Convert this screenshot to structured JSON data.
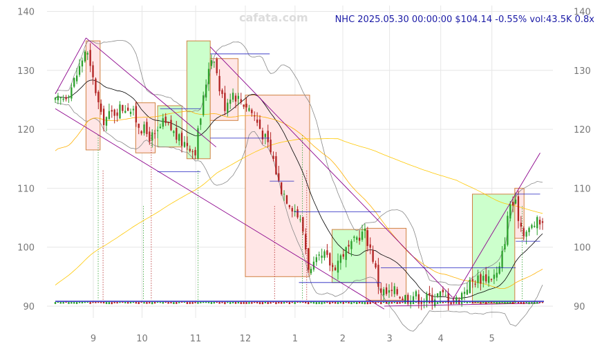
{
  "watermark": "cafata.com",
  "header": {
    "text": "NHC 2025.05.30 00:00:00 $104.14 -0.55% vol:43.5K 0.8x"
  },
  "colors": {
    "up": "#2ca02c",
    "down": "#b22222",
    "bollinger": "#888888",
    "ma_short": "#000000",
    "ma_mid": "#ffb000",
    "ma_long": "#ffc800",
    "trendline": "#8b008b",
    "level_line": "#1f1fbf",
    "box_up_fill": "#ccffcc",
    "box_down_fill": "#ffe6e6",
    "box_stroke": "#d08040",
    "grid": "#e6e6e6"
  },
  "chart_data": {
    "type": "candlestick",
    "ticker": "NHC",
    "ylim": [
      88,
      141
    ],
    "y_ticks": [
      90,
      100,
      110,
      120,
      130,
      140
    ],
    "x_ticks": [
      {
        "label": "9",
        "t": 0.078
      },
      {
        "label": "10",
        "t": 0.178
      },
      {
        "label": "11",
        "t": 0.288
      },
      {
        "label": "12",
        "t": 0.39
      },
      {
        "label": "1",
        "t": 0.492
      },
      {
        "label": "2",
        "t": 0.59
      },
      {
        "label": "3",
        "t": 0.686
      },
      {
        "label": "4",
        "t": 0.791
      },
      {
        "label": "5",
        "t": 0.896
      }
    ],
    "price_anchors": [
      [
        0.0,
        124.5
      ],
      [
        0.018,
        125.5
      ],
      [
        0.035,
        127.5
      ],
      [
        0.05,
        130.5
      ],
      [
        0.063,
        134.0
      ],
      [
        0.072,
        130.0
      ],
      [
        0.082,
        127.0
      ],
      [
        0.095,
        121.5
      ],
      [
        0.105,
        122.0
      ],
      [
        0.13,
        123.5
      ],
      [
        0.15,
        124.0
      ],
      [
        0.17,
        121.0
      ],
      [
        0.19,
        119.0
      ],
      [
        0.205,
        118.5
      ],
      [
        0.22,
        121.0
      ],
      [
        0.238,
        120.0
      ],
      [
        0.255,
        118.0
      ],
      [
        0.275,
        117.5
      ],
      [
        0.286,
        116.0
      ],
      [
        0.298,
        122.0
      ],
      [
        0.315,
        131.0
      ],
      [
        0.325,
        133.0
      ],
      [
        0.335,
        127.5
      ],
      [
        0.348,
        124.0
      ],
      [
        0.362,
        126.5
      ],
      [
        0.378,
        125.0
      ],
      [
        0.395,
        124.0
      ],
      [
        0.41,
        122.0
      ],
      [
        0.43,
        118.5
      ],
      [
        0.447,
        115.0
      ],
      [
        0.46,
        110.5
      ],
      [
        0.478,
        108.0
      ],
      [
        0.495,
        106.0
      ],
      [
        0.508,
        103.0
      ],
      [
        0.522,
        95.5
      ],
      [
        0.538,
        97.5
      ],
      [
        0.553,
        98.5
      ],
      [
        0.57,
        96.5
      ],
      [
        0.59,
        99.0
      ],
      [
        0.608,
        100.0
      ],
      [
        0.622,
        102.0
      ],
      [
        0.635,
        102.5
      ],
      [
        0.65,
        99.0
      ],
      [
        0.665,
        93.0
      ],
      [
        0.68,
        92.0
      ],
      [
        0.7,
        92.5
      ],
      [
        0.715,
        91.5
      ],
      [
        0.735,
        92.0
      ],
      [
        0.755,
        91.0
      ],
      [
        0.77,
        91.5
      ],
      [
        0.788,
        92.0
      ],
      [
        0.805,
        91.5
      ],
      [
        0.825,
        91.0
      ],
      [
        0.845,
        93.5
      ],
      [
        0.862,
        94.5
      ],
      [
        0.88,
        95.0
      ],
      [
        0.897,
        95.0
      ],
      [
        0.91,
        95.5
      ],
      [
        0.92,
        100.0
      ],
      [
        0.933,
        107.5
      ],
      [
        0.945,
        107.0
      ],
      [
        0.958,
        103.0
      ],
      [
        0.97,
        102.5
      ],
      [
        0.982,
        104.0
      ],
      [
        1.0,
        104.14
      ]
    ],
    "last_close": 104.14,
    "change_pct": -0.55,
    "volume": "43.5K",
    "volume_ratio": "0.8x",
    "date": "2025.05.30 00:00:00",
    "boxes": [
      {
        "t0": 0.063,
        "t1": 0.092,
        "top": 135.0,
        "bottom": 116.5,
        "dir": "down"
      },
      {
        "t0": 0.165,
        "t1": 0.205,
        "top": 124.5,
        "bottom": 116.0,
        "dir": "down"
      },
      {
        "t0": 0.21,
        "t1": 0.26,
        "top": 124.0,
        "bottom": 117.0,
        "dir": "up"
      },
      {
        "t0": 0.27,
        "t1": 0.318,
        "top": 135.0,
        "bottom": 115.0,
        "dir": "up"
      },
      {
        "t0": 0.318,
        "t1": 0.375,
        "top": 132.0,
        "bottom": 121.5,
        "dir": "down"
      },
      {
        "t0": 0.39,
        "t1": 0.522,
        "top": 125.8,
        "bottom": 95.0,
        "dir": "down"
      },
      {
        "t0": 0.568,
        "t1": 0.638,
        "top": 103.0,
        "bottom": 94.0,
        "dir": "up"
      },
      {
        "t0": 0.638,
        "t1": 0.72,
        "top": 103.2,
        "bottom": 91.0,
        "dir": "down"
      },
      {
        "t0": 0.856,
        "t1": 0.943,
        "top": 109.0,
        "bottom": 90.5,
        "dir": "up"
      },
      {
        "t0": 0.943,
        "t1": 0.962,
        "top": 110.0,
        "bottom": 101.5,
        "dir": "down"
      }
    ],
    "level_lines": [
      {
        "t0": 0.215,
        "t1": 0.298,
        "y": 123.5
      },
      {
        "t0": 0.21,
        "t1": 0.298,
        "y": 112.8
      },
      {
        "t0": 0.318,
        "t1": 0.44,
        "y": 132.8
      },
      {
        "t0": 0.318,
        "t1": 0.44,
        "y": 118.5
      },
      {
        "t0": 0.44,
        "t1": 0.49,
        "y": 111.2
      },
      {
        "t0": 0.49,
        "t1": 0.668,
        "y": 106.0
      },
      {
        "t0": 0.5,
        "t1": 0.668,
        "y": 94.0
      },
      {
        "t0": 0.668,
        "t1": 0.945,
        "y": 96.5
      },
      {
        "t0": 0.945,
        "t1": 0.995,
        "y": 109.0
      },
      {
        "t0": 0.945,
        "t1": 0.995,
        "y": 101.0
      }
    ],
    "trendlines": [
      {
        "t0": 0.0,
        "y0": 126.0,
        "t1": 0.063,
        "y1": 135.5
      },
      {
        "t0": 0.063,
        "y0": 135.5,
        "t1": 0.33,
        "y1": 117.0
      },
      {
        "t0": 0.0,
        "y0": 123.5,
        "t1": 0.675,
        "y1": 89.5
      },
      {
        "t0": 0.318,
        "y0": 134.0,
        "t1": 0.815,
        "y1": 91.5
      },
      {
        "t0": 0.675,
        "y0": 90.0,
        "t1": 0.995,
        "y1": 90.5
      },
      {
        "t0": 0.815,
        "y0": 91.0,
        "t1": 0.995,
        "y1": 116.0
      }
    ],
    "signal_markers_t": [
      0.088,
      0.098,
      0.181,
      0.197,
      0.293,
      0.45,
      0.507,
      0.516,
      0.958
    ]
  }
}
